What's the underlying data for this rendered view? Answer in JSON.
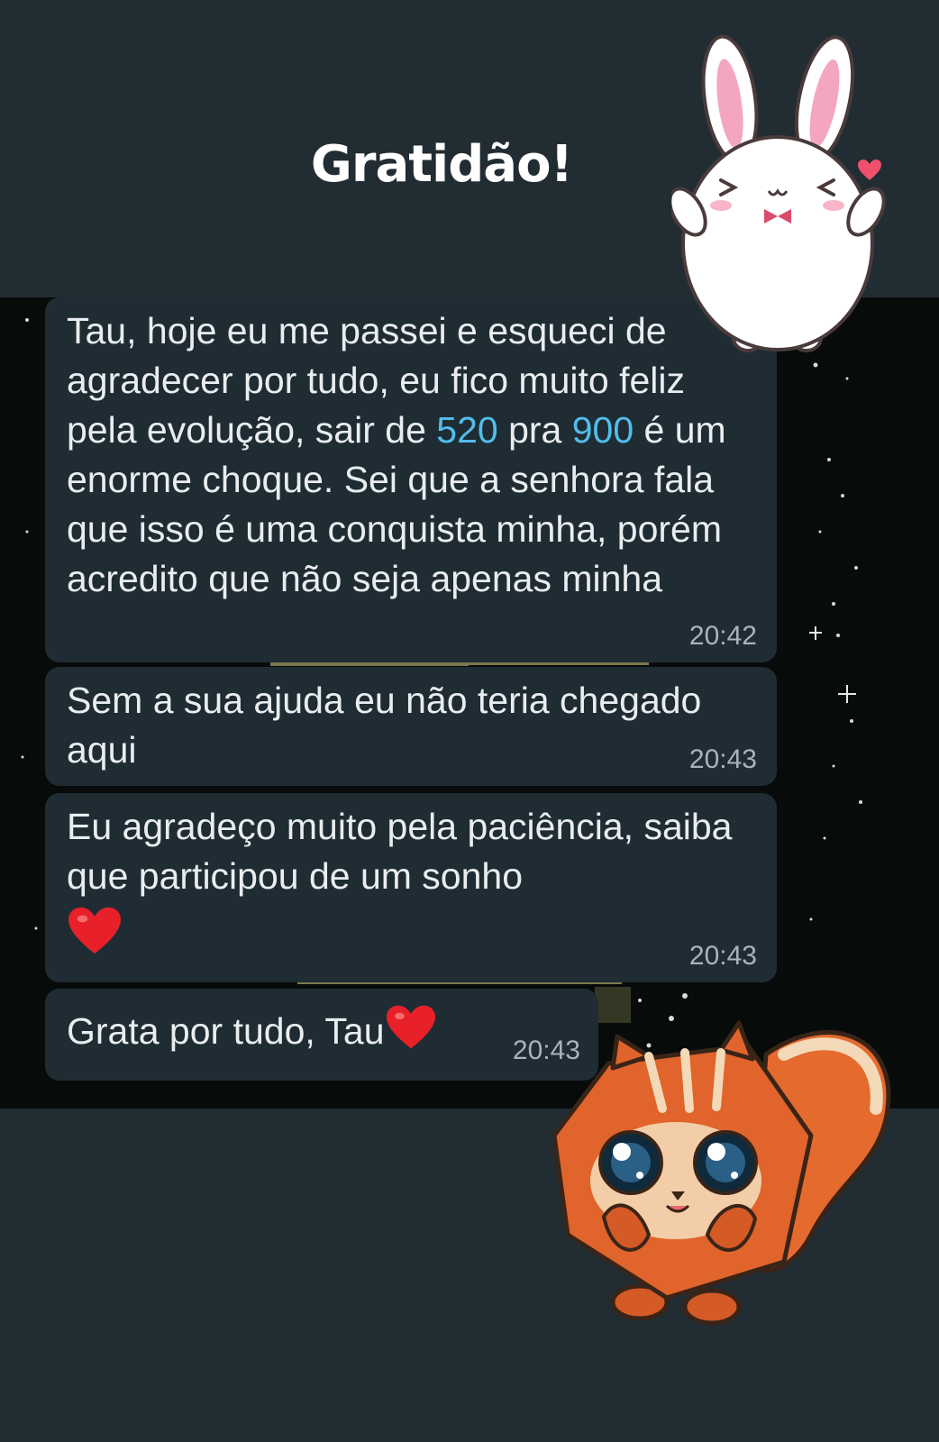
{
  "header": {
    "title": "Gratidão!"
  },
  "messages": [
    {
      "text_part1": "Tau, hoje eu me passei e esqueci de agradecer por tudo, eu fico muito feliz pela evolução, sair de ",
      "number_from": "520",
      "text_part2": " pra ",
      "number_to": "900",
      "text_part3": " é um enorme choque. Sei que a senhora fala que isso é uma conquista minha, porém acredito que não seja apenas minha",
      "time": "20:42"
    },
    {
      "text": "Sem a sua ajuda eu não teria chegado aqui",
      "time": "20:43"
    },
    {
      "text": "Eu agradeço muito pela paciência, saiba que participou de um sonho",
      "emoji": "red-heart-icon",
      "time": "20:43"
    },
    {
      "text": "Grata por tudo, Tau",
      "emoji": "red-heart-icon",
      "time": "20:43"
    }
  ],
  "colors": {
    "background": "#222c33",
    "chat_background": "#070b0a",
    "bubble": "#1f2c34",
    "text": "#e9edef",
    "number_link": "#53bdeb",
    "timestamp": "#a9b3b9",
    "heart": "#e8202a"
  },
  "stickers": [
    "bunny-sticker",
    "squirrel-sticker"
  ]
}
